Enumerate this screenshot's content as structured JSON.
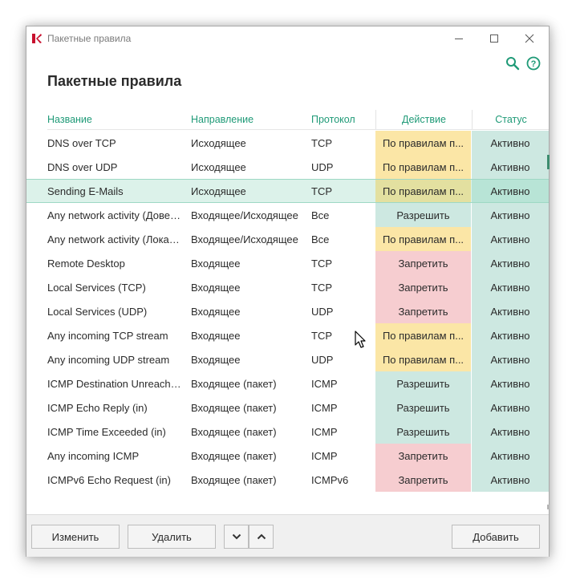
{
  "window": {
    "title": "Пакетные правила"
  },
  "heading": "Пакетные правила",
  "columns": {
    "name": "Название",
    "direction": "Направление",
    "protocol": "Протокол",
    "action": "Действие",
    "status": "Статус"
  },
  "rows": [
    {
      "name": "DNS over TCP",
      "direction": "Исходящее",
      "protocol": "TCP",
      "action": "По правилам п...",
      "action_type": "rule",
      "status": "Активно"
    },
    {
      "name": "DNS over UDP",
      "direction": "Исходящее",
      "protocol": "UDP",
      "action": "По правилам п...",
      "action_type": "rule",
      "status": "Активно"
    },
    {
      "name": "Sending E-Mails",
      "direction": "Исходящее",
      "protocol": "TCP",
      "action": "По правилам п...",
      "action_type": "rule",
      "status": "Активно",
      "selected": true
    },
    {
      "name": "Any network activity (Довере...",
      "direction": "Входящее/Исходящее",
      "protocol": "Все",
      "action": "Разрешить",
      "action_type": "allow",
      "status": "Активно"
    },
    {
      "name": "Any network activity (Локаль...",
      "direction": "Входящее/Исходящее",
      "protocol": "Все",
      "action": "По правилам п...",
      "action_type": "rule",
      "status": "Активно"
    },
    {
      "name": "Remote Desktop",
      "direction": "Входящее",
      "protocol": "TCP",
      "action": "Запретить",
      "action_type": "deny",
      "status": "Активно"
    },
    {
      "name": "Local Services (TCP)",
      "direction": "Входящее",
      "protocol": "TCP",
      "action": "Запретить",
      "action_type": "deny",
      "status": "Активно"
    },
    {
      "name": "Local Services (UDP)",
      "direction": "Входящее",
      "protocol": "UDP",
      "action": "Запретить",
      "action_type": "deny",
      "status": "Активно"
    },
    {
      "name": "Any incoming TCP stream",
      "direction": "Входящее",
      "protocol": "TCP",
      "action": "По правилам п...",
      "action_type": "rule",
      "status": "Активно"
    },
    {
      "name": "Any incoming UDP stream",
      "direction": "Входящее",
      "protocol": "UDP",
      "action": "По правилам п...",
      "action_type": "rule",
      "status": "Активно"
    },
    {
      "name": "ICMP Destination Unreachabl...",
      "direction": "Входящее (пакет)",
      "protocol": "ICMP",
      "action": "Разрешить",
      "action_type": "allow",
      "status": "Активно"
    },
    {
      "name": "ICMP Echo Reply (in)",
      "direction": "Входящее (пакет)",
      "protocol": "ICMP",
      "action": "Разрешить",
      "action_type": "allow",
      "status": "Активно"
    },
    {
      "name": "ICMP Time Exceeded (in)",
      "direction": "Входящее (пакет)",
      "protocol": "ICMP",
      "action": "Разрешить",
      "action_type": "allow",
      "status": "Активно"
    },
    {
      "name": "Any incoming ICMP",
      "direction": "Входящее (пакет)",
      "protocol": "ICMP",
      "action": "Запретить",
      "action_type": "deny",
      "status": "Активно"
    },
    {
      "name": "ICMPv6 Echo Request (in)",
      "direction": "Входящее (пакет)",
      "protocol": "ICMPv6",
      "action": "Запретить",
      "action_type": "deny",
      "status": "Активно"
    }
  ],
  "buttons": {
    "edit": "Изменить",
    "delete": "Удалить",
    "add": "Добавить"
  },
  "colors": {
    "accent": "#1f9a77",
    "rule": "#fbe6a6",
    "allow": "#cde8e1",
    "deny": "#f6cdd0",
    "status": "#cde8e1"
  },
  "icons": [
    "kaspersky-logo-icon",
    "minimize-icon",
    "maximize-icon",
    "close-icon",
    "search-icon",
    "help-icon",
    "chevron-down-icon",
    "chevron-up-icon",
    "mouse-cursor-icon"
  ]
}
